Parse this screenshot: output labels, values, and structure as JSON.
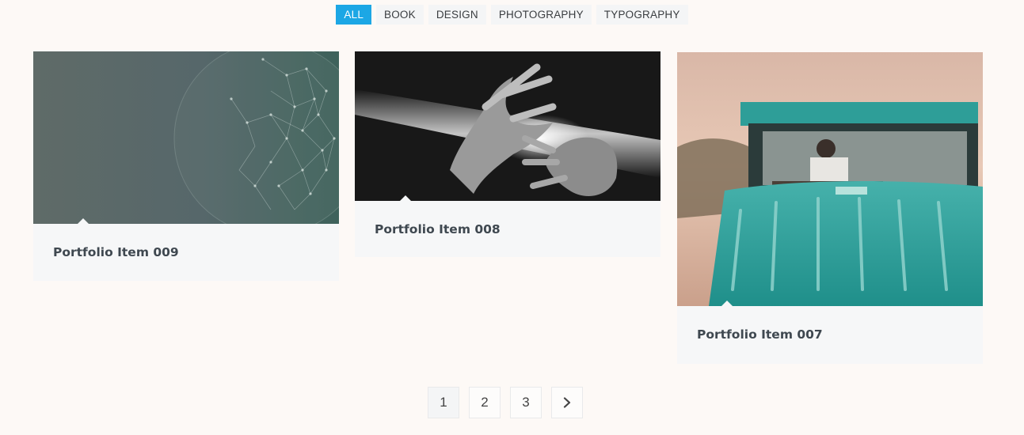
{
  "filters": [
    {
      "label": "ALL",
      "active": true
    },
    {
      "label": "BOOK",
      "active": false
    },
    {
      "label": "DESIGN",
      "active": false
    },
    {
      "label": "PHOTOGRAPHY",
      "active": false
    },
    {
      "label": "TYPOGRAPHY",
      "active": false
    }
  ],
  "portfolio": {
    "items": [
      {
        "title": "Portfolio Item 009",
        "image": "network-globe"
      },
      {
        "title": "Portfolio Item 008",
        "image": "hands-light-beam"
      },
      {
        "title": "Portfolio Item 007",
        "image": "teal-vintage-car"
      }
    ]
  },
  "pagination": {
    "pages": [
      "1",
      "2",
      "3"
    ],
    "current": "1",
    "next_icon": "chevron-right-icon"
  },
  "colors": {
    "accent": "#1ca7e5",
    "background": "#fdf9f6",
    "card": "#f6f7f8"
  }
}
